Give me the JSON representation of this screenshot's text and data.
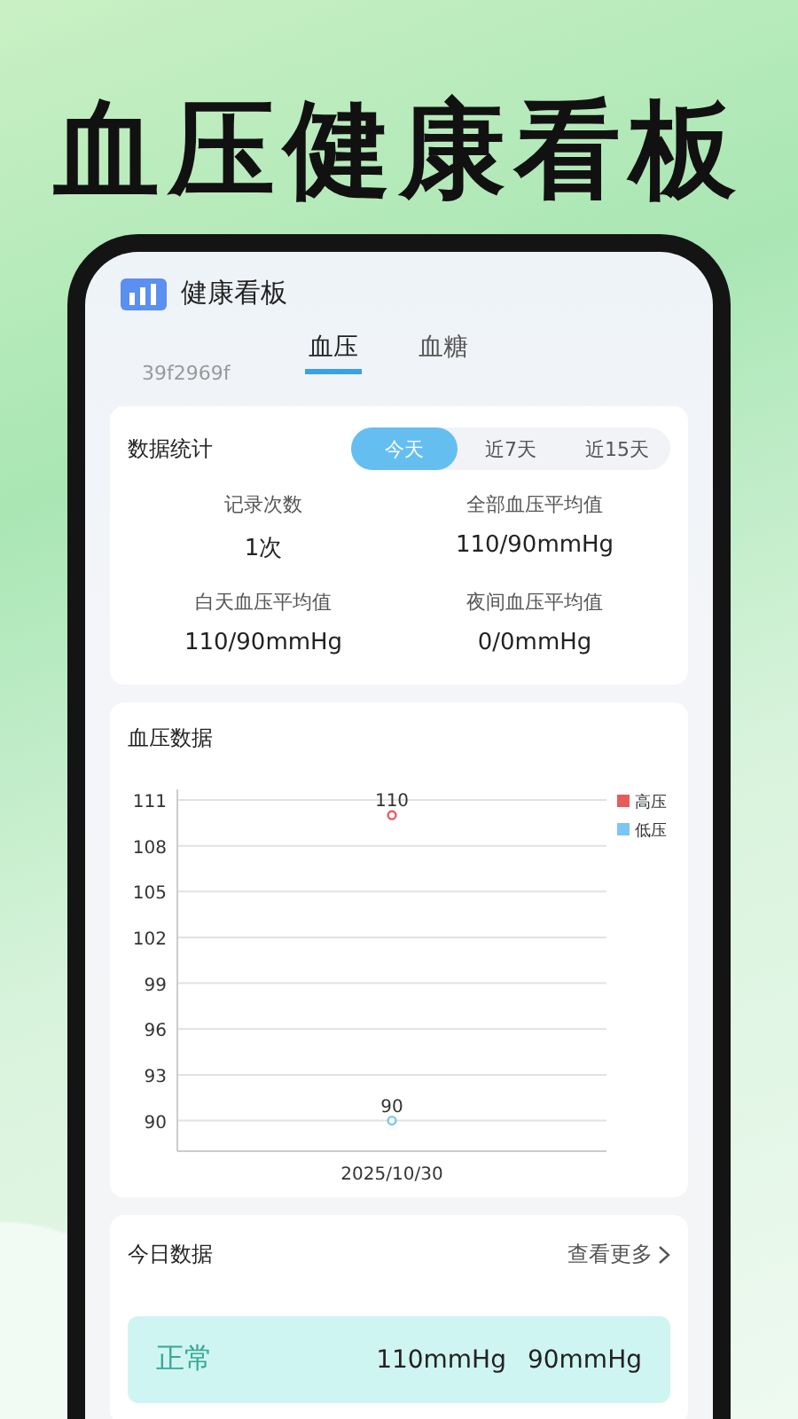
{
  "headline": "血压健康看板",
  "app": {
    "title": "健康看板"
  },
  "device_id": "39f2969f",
  "tabs": [
    {
      "label": "血压",
      "selected": true
    },
    {
      "label": "血糖",
      "selected": false
    }
  ],
  "stats": {
    "title": "数据统计",
    "periods": [
      {
        "label": "今天",
        "selected": true
      },
      {
        "label": "近7天",
        "selected": false
      },
      {
        "label": "近15天",
        "selected": false
      }
    ],
    "items": [
      {
        "label": "记录次数",
        "value": "1次"
      },
      {
        "label": "全部血压平均值",
        "value": "110/90mmHg"
      },
      {
        "label": "白天血压平均值",
        "value": "110/90mmHg"
      },
      {
        "label": "夜间血压平均值",
        "value": "0/0mmHg"
      }
    ]
  },
  "chart_card": {
    "title": "血压数据",
    "chart_data": {
      "type": "line",
      "categories": [
        "2025/10/30"
      ],
      "series": [
        {
          "name": "高压",
          "color": "#e85b5b",
          "values": [
            110
          ],
          "marker": "circle"
        },
        {
          "name": "低压",
          "color": "#7cc6f2",
          "values": [
            90
          ],
          "marker": "circle"
        }
      ],
      "grid": true,
      "legend": true,
      "ylim": [
        88,
        111
      ],
      "yticks": [
        90,
        93,
        96,
        99,
        102,
        105,
        108,
        111
      ],
      "data_labels": true
    }
  },
  "today": {
    "title": "今日数据",
    "more": "查看更多",
    "records": [
      {
        "status": "正常",
        "systolic": "110mmHg",
        "diastolic": "90mmHg"
      }
    ]
  }
}
